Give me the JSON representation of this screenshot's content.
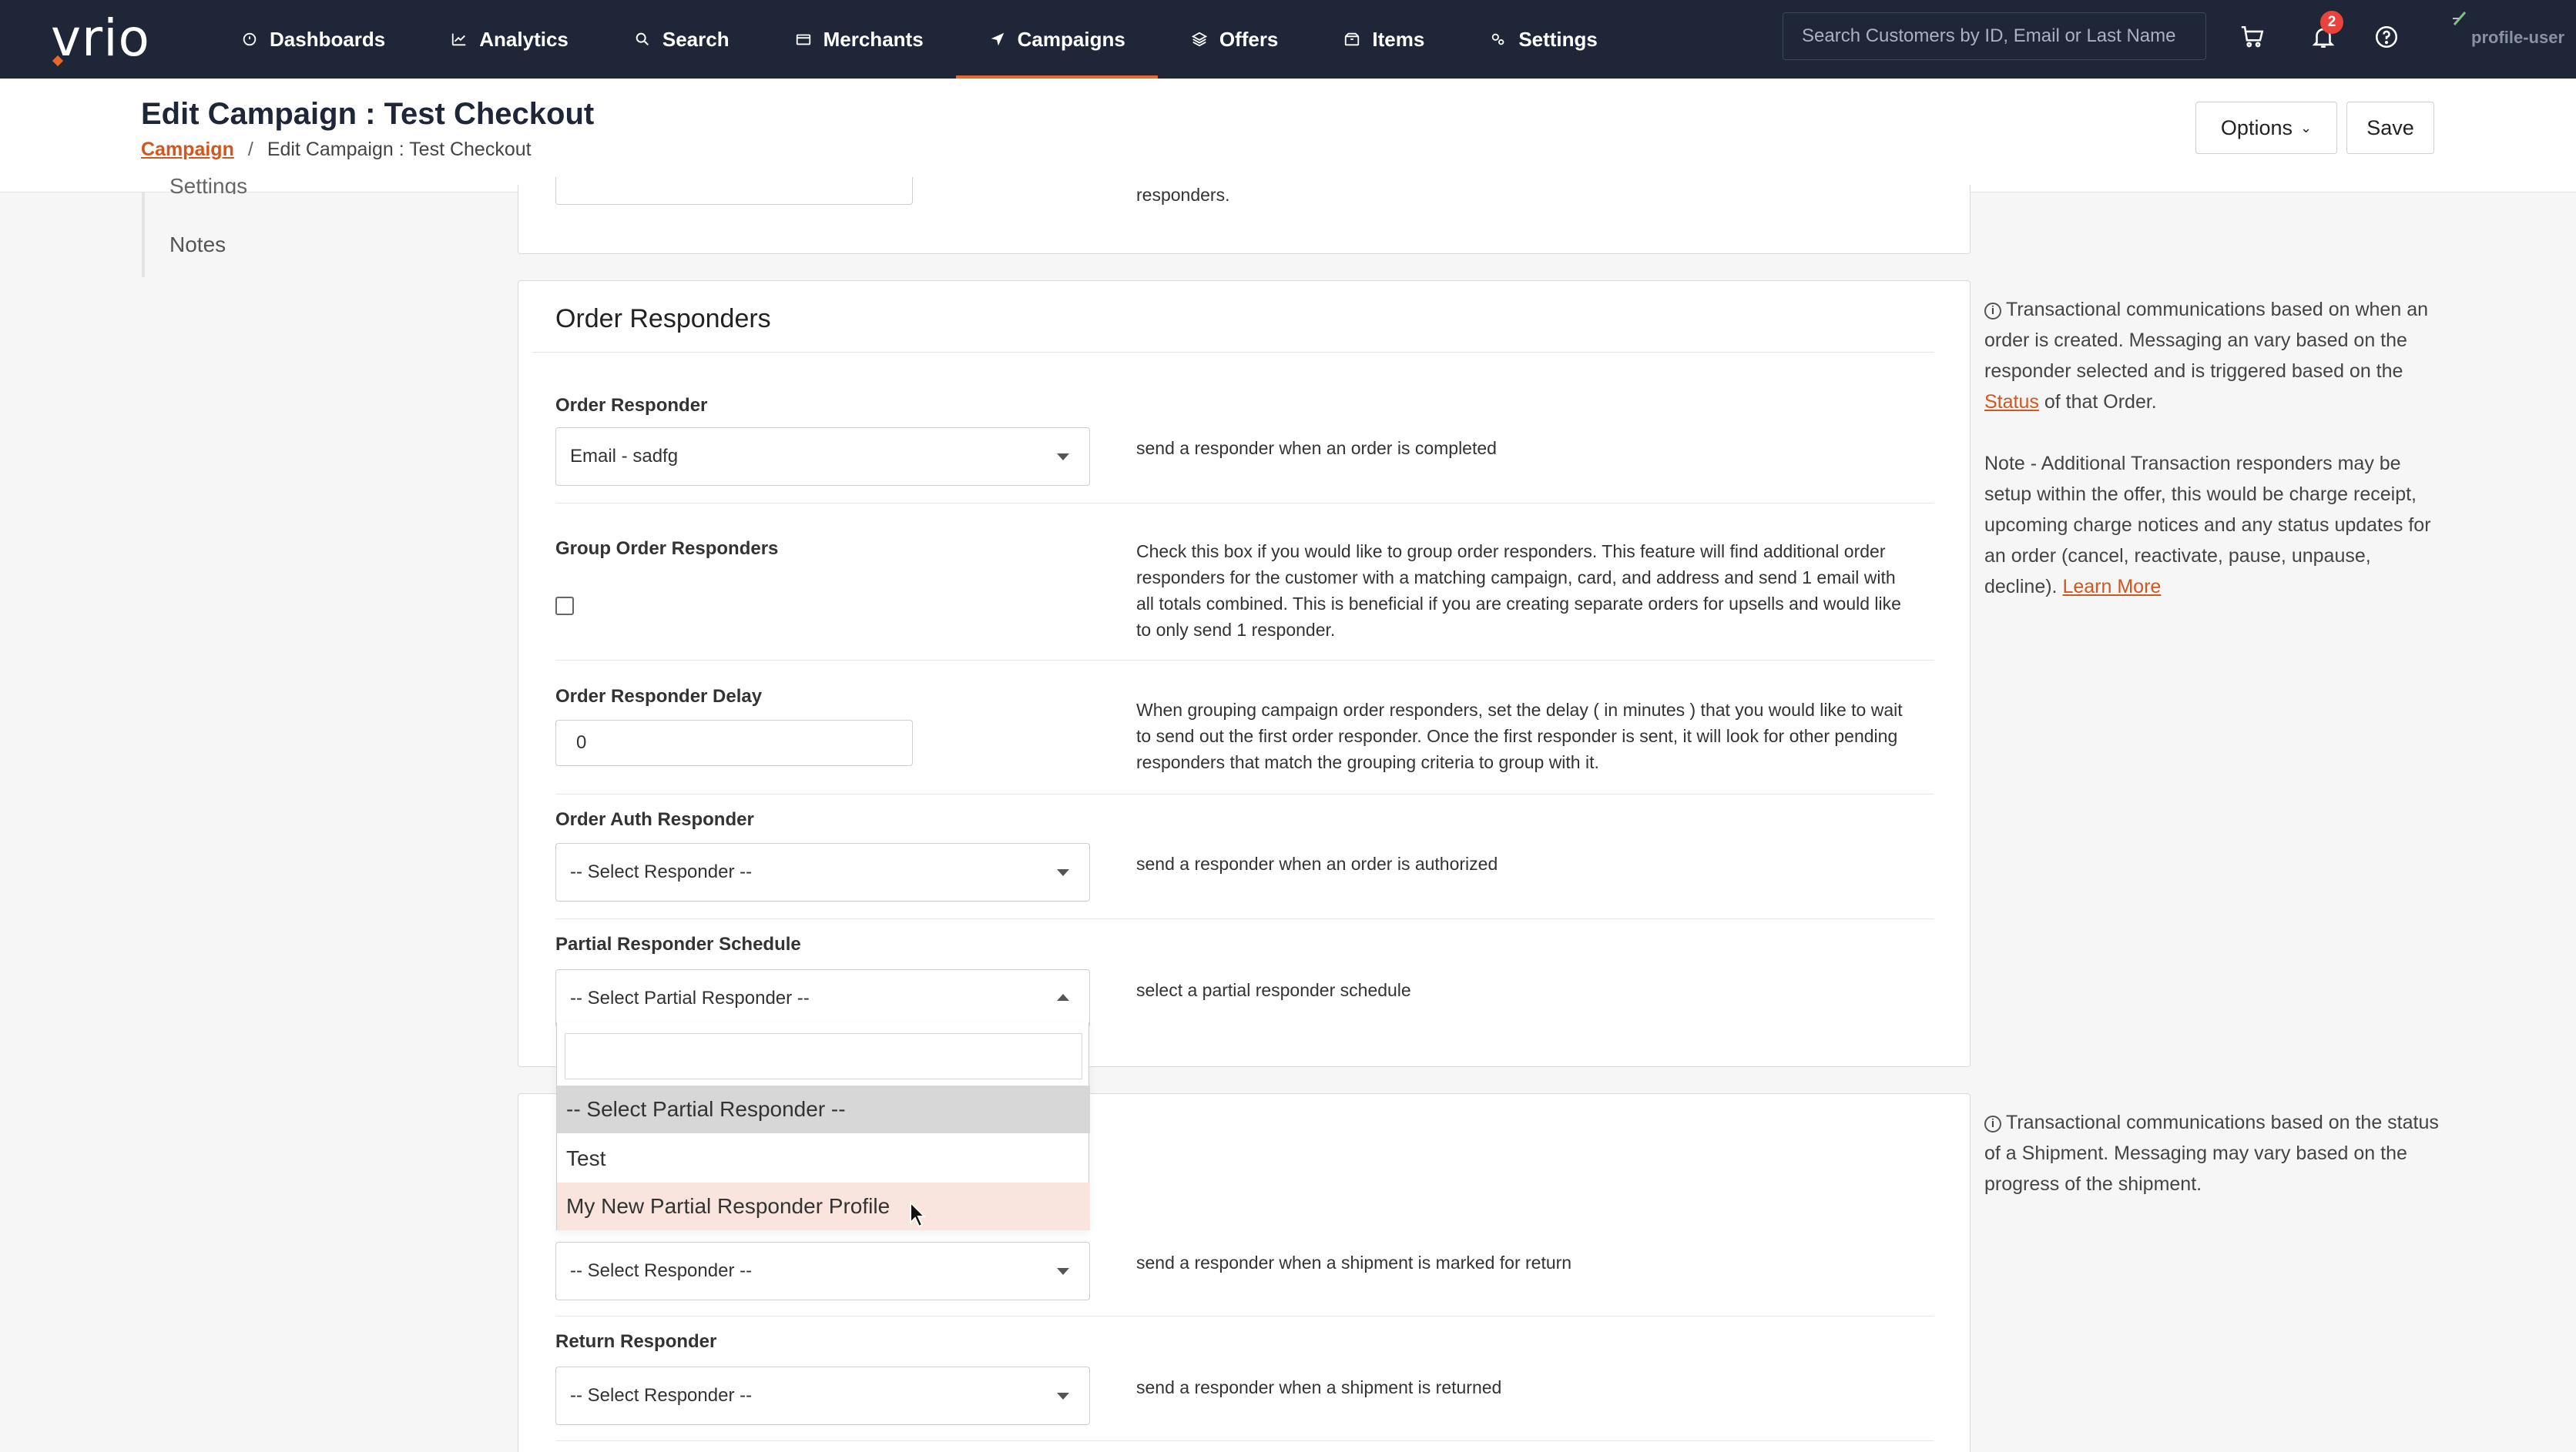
{
  "brand": {
    "logo": "vrio",
    "accent": "#e8672c",
    "nav_bg": "#1e2638"
  },
  "nav": {
    "items": [
      {
        "label": "Dashboards",
        "icon": "dashboard-icon"
      },
      {
        "label": "Analytics",
        "icon": "analytics-icon"
      },
      {
        "label": "Search",
        "icon": "search-icon"
      },
      {
        "label": "Merchants",
        "icon": "merchants-icon"
      },
      {
        "label": "Campaigns",
        "icon": "campaigns-icon",
        "active": true
      },
      {
        "label": "Offers",
        "icon": "offers-icon"
      },
      {
        "label": "Items",
        "icon": "items-icon"
      },
      {
        "label": "Settings",
        "icon": "settings-icon"
      }
    ],
    "search_placeholder": "Search Customers by ID, Email or Last Name",
    "notification_count": "2",
    "profile_label": "profile-user"
  },
  "header": {
    "title": "Edit Campaign : Test Checkout",
    "breadcrumb_link": "Campaign",
    "breadcrumb_sep": "/",
    "breadcrumb_current": "Edit Campaign : Test Checkout",
    "options_label": "Options",
    "save_label": "Save"
  },
  "leftnav": {
    "partial_item": "Settings",
    "notes_label": "Notes"
  },
  "top_card": {
    "desc_tail": "responders."
  },
  "order_responders": {
    "title": "Order Responders",
    "fields": {
      "order_responder": {
        "label": "Order Responder",
        "value": "Email - sadfg",
        "desc": "send a responder when an order is completed"
      },
      "group": {
        "label": "Group Order Responders",
        "checked": false,
        "desc": "Check this box if you would like to group order responders. This feature will find additional order responders for the customer with a matching campaign, card, and address and send 1 email with all totals combined. This is beneficial if you are creating separate orders for upsells and would like to only send 1 responder."
      },
      "delay": {
        "label": "Order Responder Delay",
        "value": "0",
        "desc": "When grouping campaign order responders, set the delay ( in minutes ) that you would like to wait to send out the first order responder. Once the first responder is sent, it will look for other pending responders that match the grouping criteria to group with it."
      },
      "auth": {
        "label": "Order Auth Responder",
        "value": "-- Select Responder --",
        "desc": "send a responder when an order is authorized"
      },
      "partial": {
        "label": "Partial Responder Schedule",
        "value": "-- Select Partial Responder --",
        "desc": "select a partial responder schedule"
      }
    },
    "help_text": "Transactional communications based on when an order is created. Messaging an vary based on the responder selected and is triggered based on the",
    "help_link": "Status",
    "help_text_end": "of that Order.",
    "note_text": "Note - Additional Transaction responders may be setup within the offer, this would be charge receipt, upcoming charge notices and any status updates for an order (cancel, reactivate, pause, unpause, decline).",
    "note_link": "Learn More"
  },
  "dropdown": {
    "search_value": "",
    "options": [
      {
        "label": "-- Select Partial Responder --",
        "state": "selected"
      },
      {
        "label": "Test",
        "state": ""
      },
      {
        "label": "My New Partial Responder Profile",
        "state": "hover"
      }
    ]
  },
  "shipment_responders": {
    "fields": {
      "return_marked": {
        "value": "-- Select Responder --",
        "desc": "send a responder when a shipment is marked for return"
      },
      "returned": {
        "label": "Return Responder",
        "value": "-- Select Responder --",
        "desc": "send a responder when a shipment is returned"
      }
    },
    "help_text": "Transactional communications based on the status of a Shipment. Messaging may vary based on the progress of the shipment."
  }
}
